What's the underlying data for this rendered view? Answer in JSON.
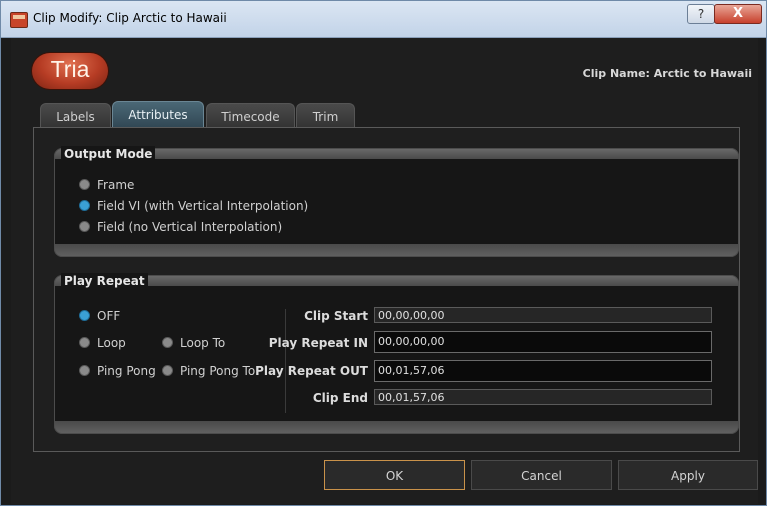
{
  "window": {
    "title": "Clip Modify: Clip Arctic to Hawaii",
    "help_label": "?",
    "close_label": "X"
  },
  "header": {
    "logo_text": "Tria",
    "clip_name": "Clip Name: Arctic to Hawaii"
  },
  "tabs": [
    {
      "label": "Labels",
      "active": false
    },
    {
      "label": "Attributes",
      "active": true
    },
    {
      "label": "Timecode",
      "active": false
    },
    {
      "label": "Trim",
      "active": false
    }
  ],
  "output_mode": {
    "title": "Output Mode",
    "options": [
      {
        "label": "Frame",
        "selected": false
      },
      {
        "label": "Field VI (with Vertical Interpolation)",
        "selected": true
      },
      {
        "label": "Field (no Vertical Interpolation)",
        "selected": false
      }
    ]
  },
  "play_repeat": {
    "title": "Play Repeat",
    "options": [
      {
        "label": "OFF",
        "selected": true
      },
      {
        "label": "Loop",
        "selected": false
      },
      {
        "label": "Loop To",
        "selected": false
      },
      {
        "label": "Ping Pong",
        "selected": false
      },
      {
        "label": "Ping Pong To",
        "selected": false
      }
    ],
    "fields": [
      {
        "label": "Clip Start",
        "value": "00,00,00,00",
        "editable": false
      },
      {
        "label": "Play Repeat IN",
        "value": "00,00,00,00",
        "editable": true
      },
      {
        "label": "Play Repeat OUT",
        "value": "00,01,57,06",
        "editable": true
      },
      {
        "label": "Clip End",
        "value": "00,01,57,06",
        "editable": false
      }
    ]
  },
  "buttons": {
    "ok": "OK",
    "cancel": "Cancel",
    "apply": "Apply"
  },
  "colors": {
    "accent_radio": "#3aa0d6",
    "active_tab": "#3f5a68",
    "default_button_border": "#c9924a"
  }
}
